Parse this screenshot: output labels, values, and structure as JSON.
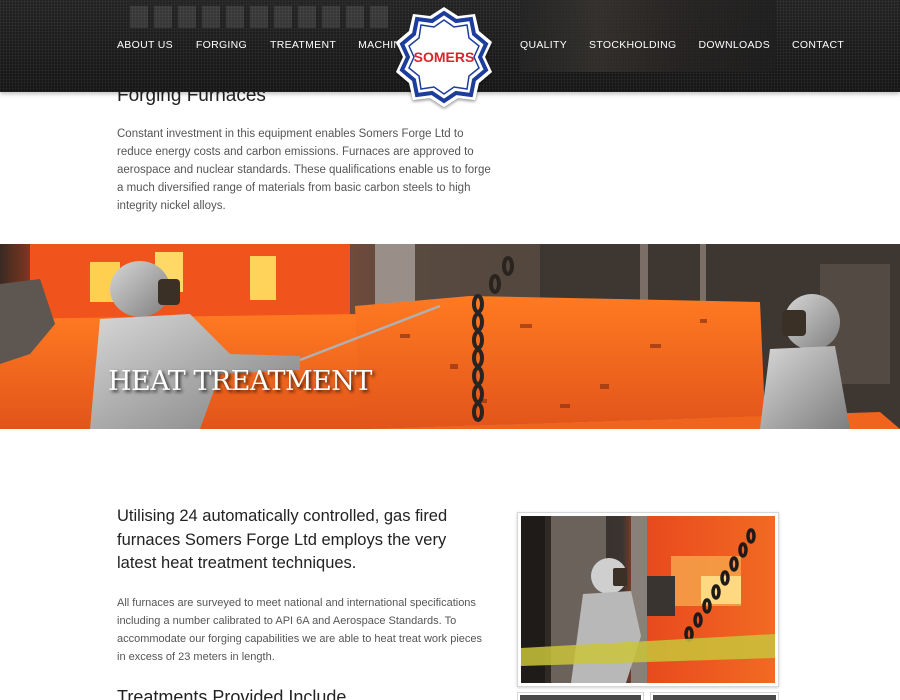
{
  "nav": {
    "left": [
      "ABOUT US",
      "FORGING",
      "TREATMENT",
      "MACHINING"
    ],
    "right": [
      "QUALITY",
      "STOCKHOLDING",
      "DOWNLOADS",
      "CONTACT"
    ]
  },
  "logo": {
    "text": "SOMERS"
  },
  "furnaces": {
    "heading": "Forging Furnaces",
    "body": "Constant investment in this equipment enables Somers Forge Ltd to reduce energy costs and carbon emissions. Furnaces are approved to aerospace and nuclear standards. These qualifications enable us to forge a much diversified range of materials from basic carbon steels to high integrity nickel alloys."
  },
  "hero": {
    "title": "HEAT TREATMENT"
  },
  "main": {
    "heading": "Utilising 24 automatically controlled, gas fired furnaces Somers Forge Ltd employs the very latest heat treatment techniques.",
    "body": "All furnaces are surveyed to meet national and international specifications including a number calibrated to API 6A and Aerospace Standards. To accommodate our forging capabilities we are able to heat treat work pieces in excess of 23 meters in length.",
    "subheading": "Treatments Provided Include"
  },
  "colors": {
    "header_bg": "#1c1c1c",
    "logo_red": "#d9232e",
    "logo_blue": "#1f3c9c",
    "hot_metal": "#f26a1b"
  }
}
